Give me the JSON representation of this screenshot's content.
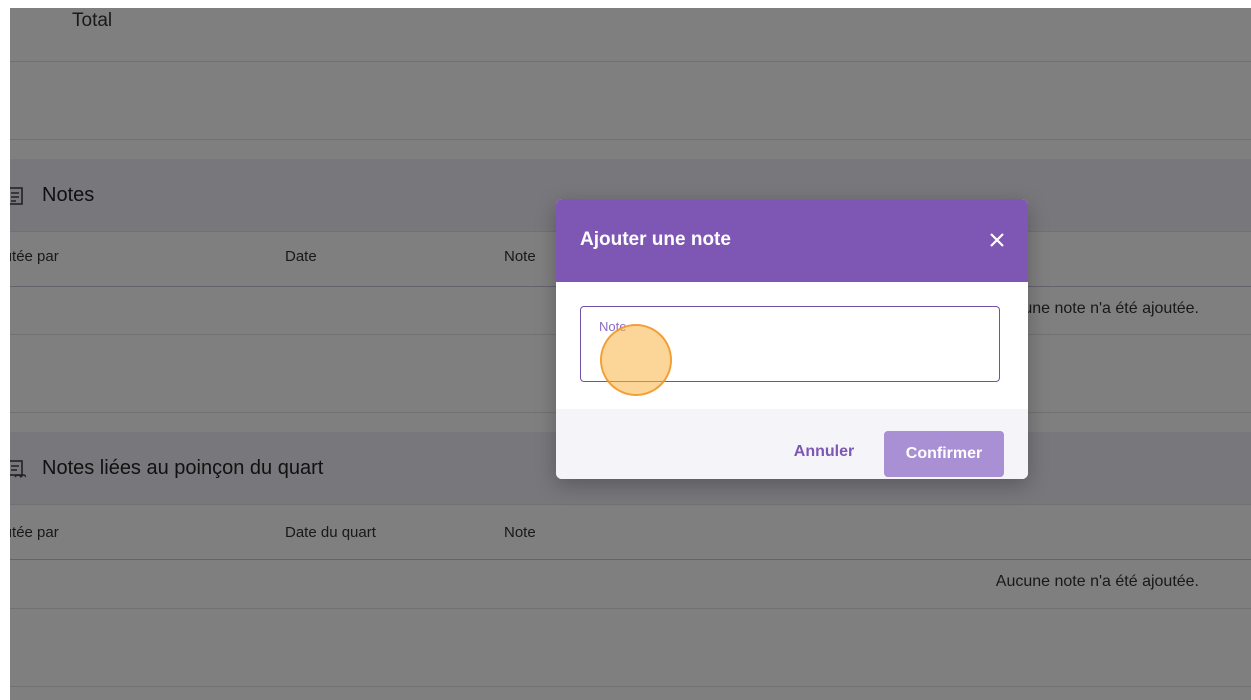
{
  "summary": {
    "total_label": "Total"
  },
  "notes_section": {
    "title": "Notes",
    "icon": "note-icon",
    "columns": [
      "Ajoutée par",
      "Date",
      "Note"
    ],
    "empty_message": "Aucune note n'a été ajoutée."
  },
  "shift_notes_section": {
    "title": "Notes liées au poinçon du quart",
    "icon": "note-link-icon",
    "columns": [
      "Ajoutée par",
      "Date du quart",
      "Note"
    ],
    "empty_message": "Aucune note n'a été ajoutée."
  },
  "dialog": {
    "title": "Ajouter une note",
    "close_icon": "close-icon",
    "field": {
      "label": "Note",
      "value": ""
    },
    "cancel_label": "Annuler",
    "confirm_label": "Confirmer"
  },
  "colors": {
    "accent": "#7e57b5",
    "confirm_disabled": "#a98fd3",
    "overlay": "rgba(0,0,0,0.5)"
  }
}
